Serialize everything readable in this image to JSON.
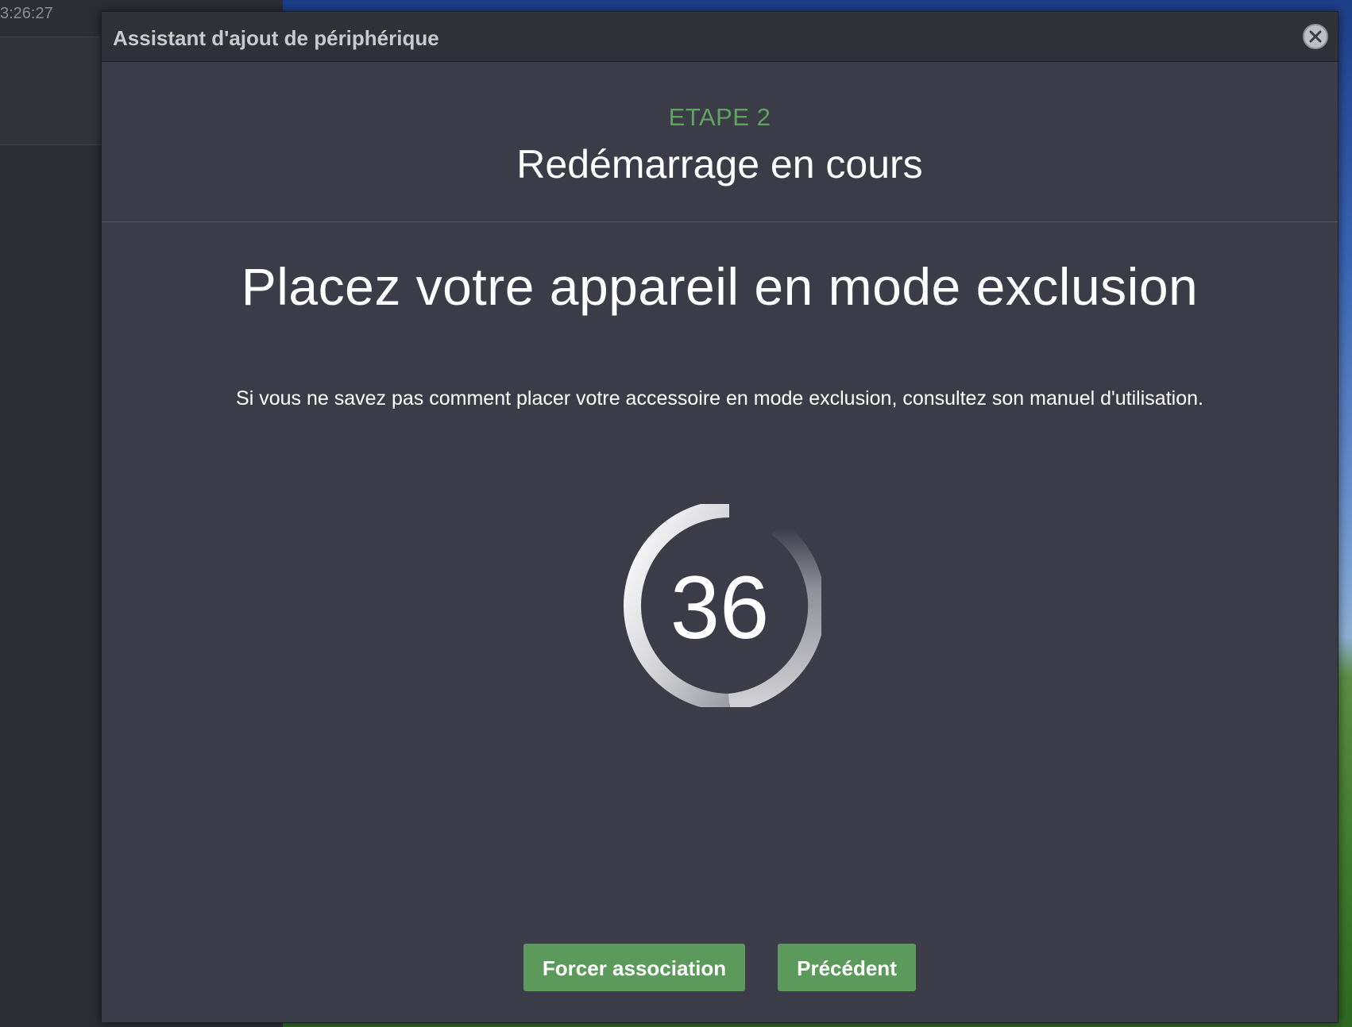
{
  "background": {
    "time_label": "3:26:27"
  },
  "modal": {
    "title": "Assistant d'ajout de périphérique",
    "close_icon": "close-icon"
  },
  "step": {
    "label": "ETAPE 2",
    "title": "Redémarrage en cours"
  },
  "main": {
    "heading": "Placez votre appareil en mode exclusion",
    "instruction": "Si vous ne savez pas comment placer votre accessoire en mode exclusion, consultez son manuel d'utilisation."
  },
  "countdown": {
    "value": "36"
  },
  "buttons": {
    "force_label": "Forcer association",
    "previous_label": "Précédent"
  },
  "colors": {
    "accent_green": "#5b9a5b",
    "step_green": "#5ea35e",
    "modal_bg": "#3b3c48",
    "header_bg": "#2f3038"
  }
}
